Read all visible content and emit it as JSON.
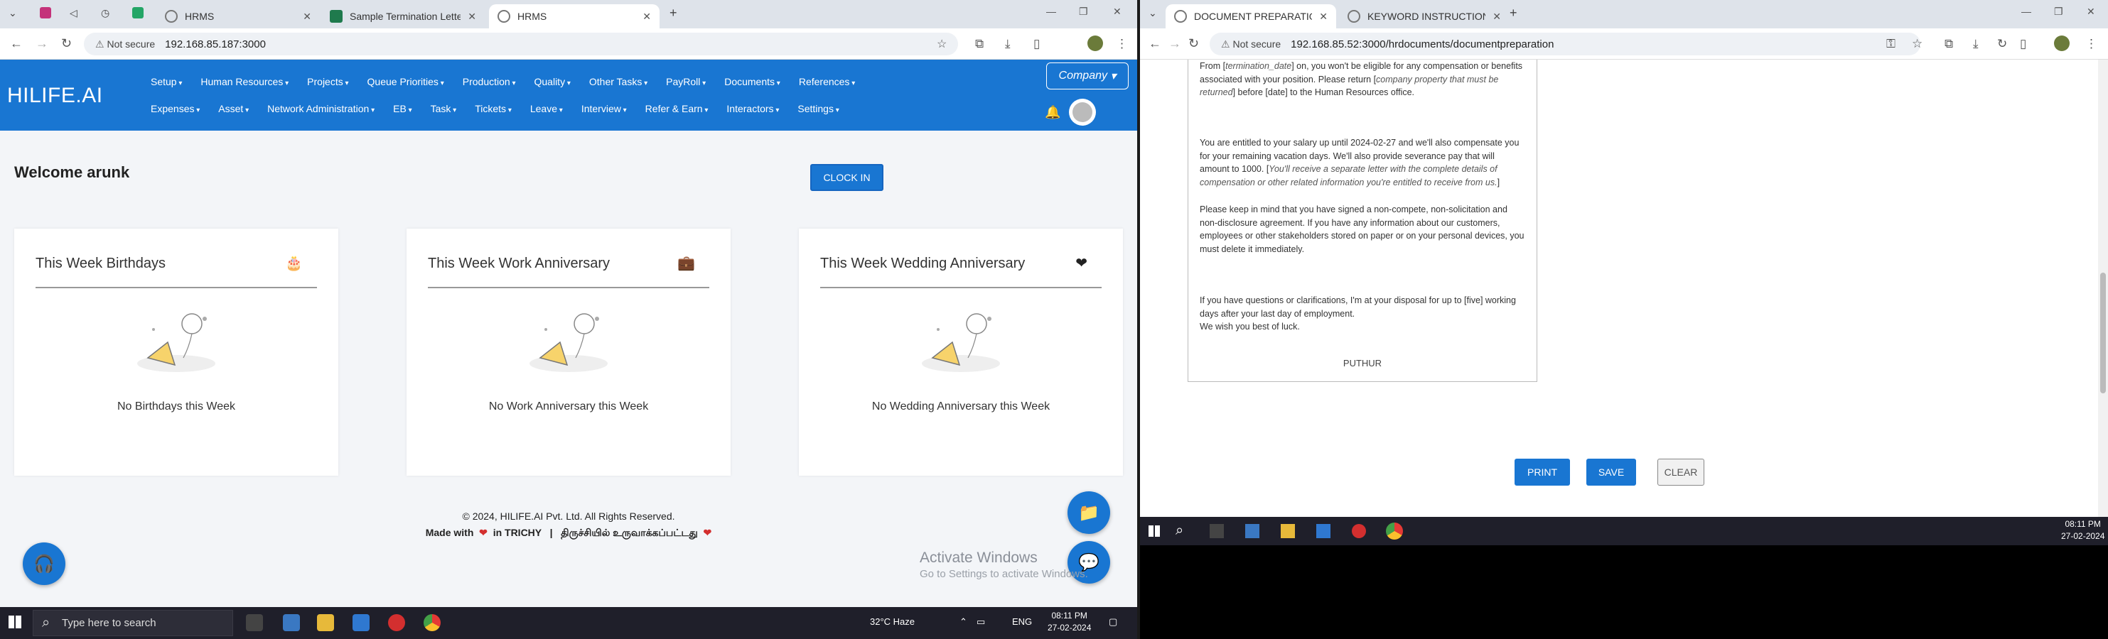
{
  "left": {
    "tabs": [
      {
        "label": "HRMS"
      },
      {
        "label": "Sample Termination Letter to Em"
      },
      {
        "label": "HRMS"
      }
    ],
    "address": {
      "security": "Not secure",
      "url": "192.168.85.187:3000"
    },
    "logo": "HILIFE.AI",
    "menu_row1": [
      "Setup",
      "Human Resources",
      "Projects",
      "Queue Priorities",
      "Production",
      "Quality",
      "Other Tasks",
      "PayRoll",
      "Documents",
      "References"
    ],
    "menu_row2": [
      "Expenses",
      "Asset",
      "Network Administration",
      "EB",
      "Task",
      "Tickets",
      "Leave",
      "Interview",
      "Refer & Earn",
      "Interactors",
      "Settings"
    ],
    "company_label": "Company",
    "welcome": "Welcome arunk",
    "clock_in": "CLOCK IN",
    "cards": [
      {
        "title": "This Week Birthdays",
        "icon": "birthday-cake-icon",
        "empty": "No Birthdays this Week"
      },
      {
        "title": "This Week Work Anniversary",
        "icon": "briefcase-icon",
        "empty": "No Work Anniversary this Week"
      },
      {
        "title": "This Week Wedding Anniversary",
        "icon": "heart-icon",
        "empty": "No Wedding Anniversary this Week"
      }
    ],
    "footer_copyright": "© 2024, HILIFE.AI Pvt. Ltd. All Rights Reserved.",
    "footer_made_with": "Made with",
    "footer_in": "in TRICHY",
    "footer_sep": "|",
    "footer_tamil": "திருச்சியில் உருவாக்கப்பட்டது",
    "activate_title": "Activate Windows",
    "activate_sub": "Go to Settings to activate Windows."
  },
  "taskbar_left": {
    "search_placeholder": "Type here to search",
    "weather": "32°C  Haze",
    "lang": "ENG",
    "time": "08:11 PM",
    "date": "27-02-2024"
  },
  "right": {
    "tabs": [
      {
        "label": "DOCUMENT PREPARATION"
      },
      {
        "label": "KEYWORD INSTRUCTIONS"
      }
    ],
    "address": {
      "security": "Not secure",
      "url": "192.168.85.52:3000/hrdocuments/documentpreparation"
    },
    "doc": {
      "p1a": "From [",
      "p1b": "termination_date",
      "p1c": "] on, you won't be eligible for any compensation or benefits associated with your position. Please return [",
      "p1d": "company property that must be returned",
      "p1e": "] before [date] to the Human Resources office.",
      "p2a": "You are entitled to your salary up until 2024-02-27 and we'll also compensate you for your remaining vacation days. We'll also provide severance pay that will amount to 1000. [",
      "p2b": "You'll receive a separate letter with the complete details of compensation or other related information you're entitled to receive from us.",
      "p2c": "]",
      "p3": "Please keep in mind that you have signed a non-compete, non-solicitation and non-disclosure agreement. If you have any information about our customers, employees or other stakeholders stored on paper or on your personal devices, you must delete it immediately.",
      "p4": "If you have questions or clarifications, I'm at your disposal for up to [five] working days after your last day of employment.",
      "p5": "We wish you best of luck.",
      "signature": "PUTHUR"
    },
    "buttons": {
      "print": "PRINT",
      "save": "SAVE",
      "clear": "CLEAR"
    }
  },
  "taskbar_right": {
    "time": "08:11 PM",
    "date": "27-02-2024"
  }
}
